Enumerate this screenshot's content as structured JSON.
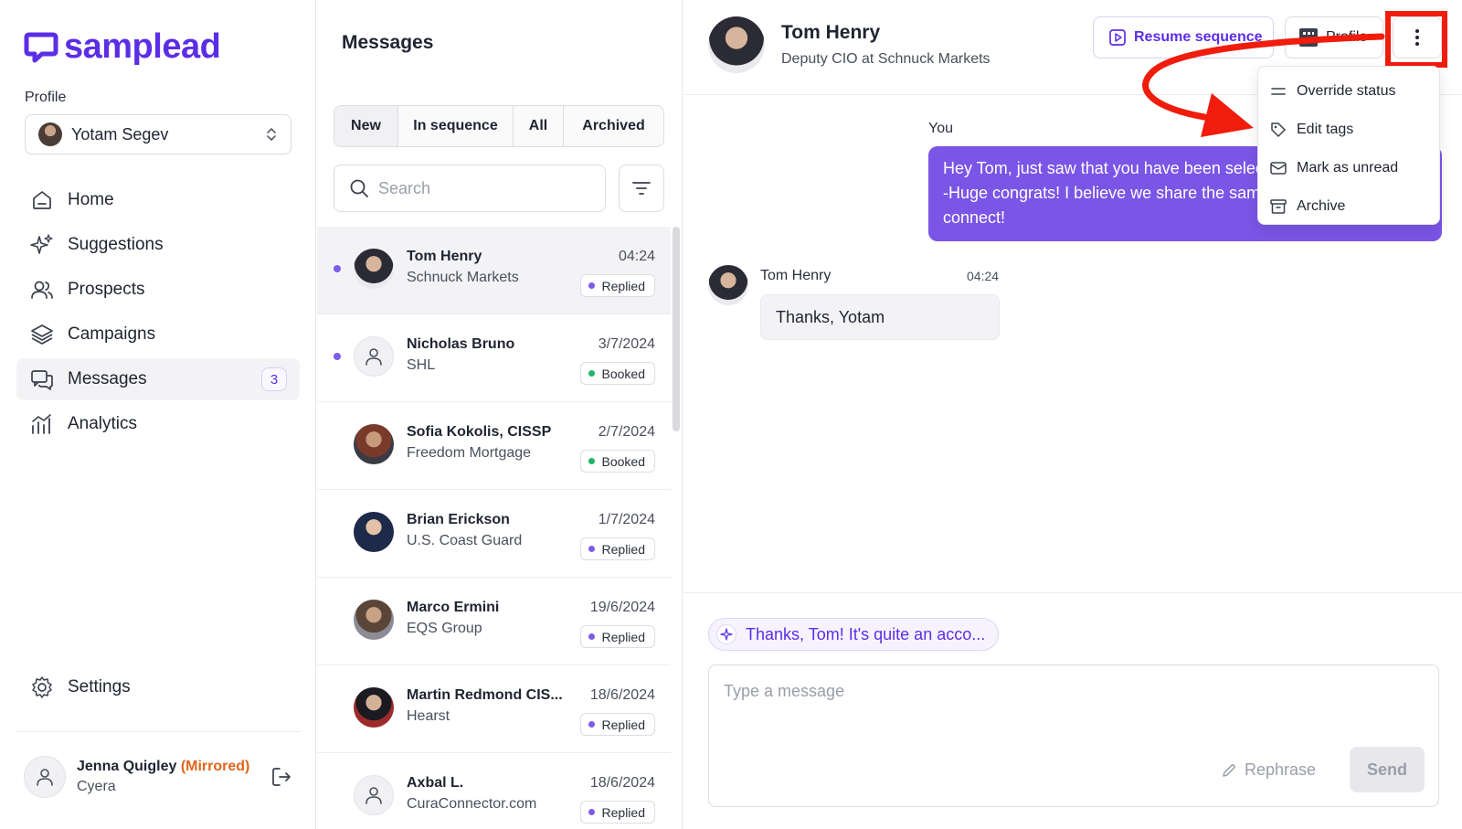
{
  "brand": {
    "name": "samplead",
    "color": "#5b2ee6"
  },
  "sidebar": {
    "profile_label": "Profile",
    "profile_name": "Yotam Segev",
    "nav": [
      {
        "label": "Home",
        "icon": "home-icon"
      },
      {
        "label": "Suggestions",
        "icon": "sparkles-icon"
      },
      {
        "label": "Prospects",
        "icon": "users-icon"
      },
      {
        "label": "Campaigns",
        "icon": "layers-icon"
      },
      {
        "label": "Messages",
        "icon": "chat-icon",
        "count": "3",
        "active": true
      },
      {
        "label": "Analytics",
        "icon": "analytics-icon"
      }
    ],
    "settings_label": "Settings",
    "user": {
      "name": "Jenna Quigley",
      "mirrored": "(Mirrored)",
      "company": "Cyera"
    }
  },
  "messages": {
    "title": "Messages",
    "filters": [
      "New",
      "In sequence",
      "All",
      "Archived"
    ],
    "search_placeholder": "Search",
    "threads": [
      {
        "name": "Tom Henry",
        "company": "Schnuck Markets",
        "date": "04:24",
        "status": "Replied",
        "unread": true
      },
      {
        "name": "Nicholas Bruno",
        "company": "SHL",
        "date": "3/7/2024",
        "status": "Booked",
        "unread": true
      },
      {
        "name": "Sofia Kokolis, CISSP",
        "company": "Freedom Mortgage",
        "date": "2/7/2024",
        "status": "Booked",
        "unread": false
      },
      {
        "name": "Brian Erickson",
        "company": "U.S. Coast Guard",
        "date": "1/7/2024",
        "status": "Replied",
        "unread": false
      },
      {
        "name": "Marco Ermini",
        "company": "EQS Group",
        "date": "19/6/2024",
        "status": "Replied",
        "unread": false
      },
      {
        "name": "Martin Redmond CIS...",
        "company": "Hearst",
        "date": "18/6/2024",
        "status": "Replied",
        "unread": false
      },
      {
        "name": "Axbal L.",
        "company": "CuraConnector.com",
        "date": "18/6/2024",
        "status": "Replied",
        "unread": false
      }
    ],
    "status_colors": {
      "Replied": "#7c5ce8",
      "Booked": "#22b566"
    }
  },
  "conversation": {
    "contact_name": "Tom Henry",
    "contact_title": "Deputy CIO at Schnuck Markets",
    "resume_label": "Resume sequence",
    "profile_label": "Profile",
    "menu": [
      {
        "label": "Override status",
        "icon": "equals-icon"
      },
      {
        "label": "Edit tags",
        "icon": "tag-icon"
      },
      {
        "label": "Mark as unread",
        "icon": "envelope-icon"
      },
      {
        "label": "Archive",
        "icon": "archive-icon"
      }
    ],
    "you_label": "You",
    "outgoing_text": "Hey Tom, just saw that you have been selected to the Data IQ list -Huge congrats! I believe we share the same field, would love to connect!",
    "incoming_name": "Tom Henry",
    "incoming_time": "04:24",
    "incoming_text": "Thanks, Yotam",
    "suggestion": "Thanks, Tom! It's quite an acco...",
    "composer_placeholder": "Type a message",
    "rephrase_label": "Rephrase",
    "send_label": "Send"
  },
  "annotation_color": "#f01c0c"
}
